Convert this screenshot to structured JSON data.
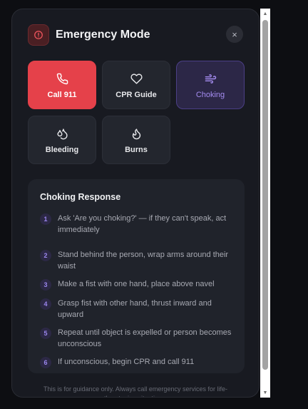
{
  "header": {
    "title": "Emergency Mode",
    "close_glyph": "×",
    "icons": {
      "alert": "alert-circle-icon",
      "close": "close-icon"
    }
  },
  "tiles": [
    {
      "label": "Call 911",
      "icon": "phone-icon",
      "style": "red"
    },
    {
      "label": "CPR Guide",
      "icon": "heart-icon",
      "style": "default"
    },
    {
      "label": "Choking",
      "icon": "wind-icon",
      "style": "selected"
    },
    {
      "label": "Bleeding",
      "icon": "droplets-icon",
      "style": "default"
    },
    {
      "label": "Burns",
      "icon": "flame-icon",
      "style": "default"
    }
  ],
  "response": {
    "title": "Choking Response",
    "steps": [
      {
        "num": "1",
        "text": "Ask 'Are you choking?' — if they can't speak, act immediately"
      },
      {
        "num": "2",
        "text": "Stand behind the person, wrap arms around their waist"
      },
      {
        "num": "3",
        "text": "Make a fist with one hand, place above navel"
      },
      {
        "num": "4",
        "text": "Grasp fist with other hand, thrust inward and upward"
      },
      {
        "num": "5",
        "text": "Repeat until object is expelled or person becomes unconscious"
      },
      {
        "num": "6",
        "text": "If unconscious, begin CPR and call 911"
      }
    ]
  },
  "footer": {
    "text": "This is for guidance only. Always call emergency services for life-threatening situations."
  },
  "colors": {
    "accent_red": "#e5414a",
    "accent_purple": "#a48cf0",
    "panel_bg": "#181a21"
  }
}
